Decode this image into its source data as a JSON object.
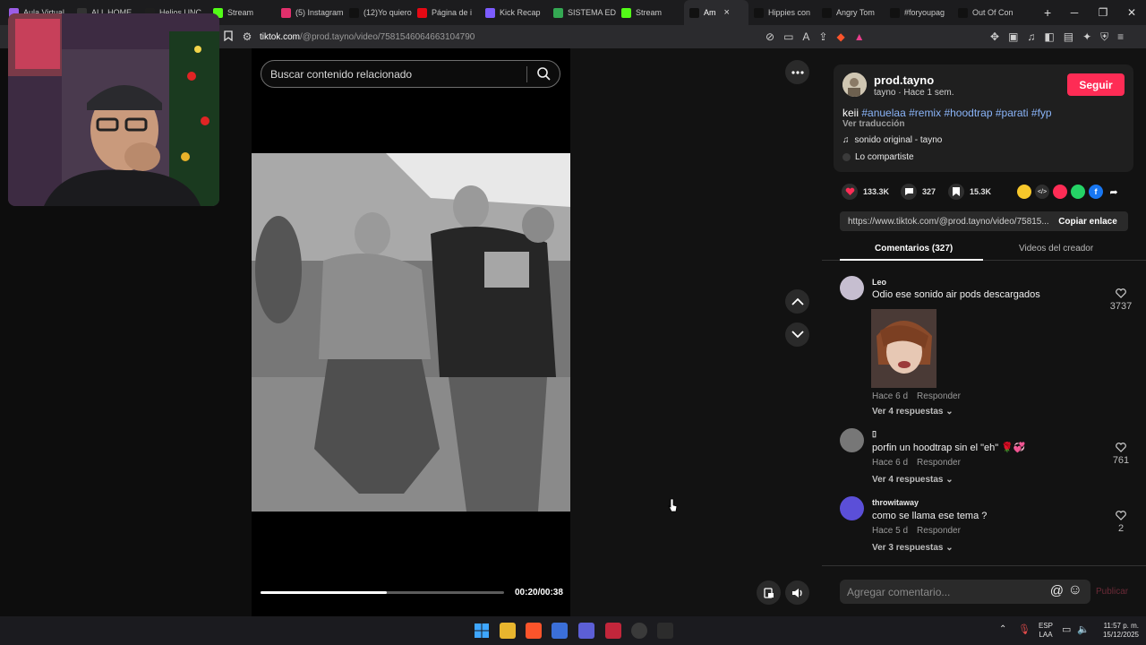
{
  "browser": {
    "tabs": [
      {
        "label": "Aula Virtual",
        "color": "#9b5de5"
      },
      {
        "label": "ALL HOME",
        "color": "#333333"
      },
      {
        "label": "Helios UNC",
        "color": "#1e1e1e"
      },
      {
        "label": "Stream",
        "color": "#53fc18"
      },
      {
        "label": "(5) Instagram",
        "color": "#e1306c"
      },
      {
        "label": "(12)Yo quiero",
        "color": "#111111"
      },
      {
        "label": "Página de i",
        "color": "#e50914"
      },
      {
        "label": "Kick Recap",
        "color": "#7c5cff"
      },
      {
        "label": "SISTEMA ED",
        "color": "#34a853"
      },
      {
        "label": "Stream",
        "color": "#53fc18"
      },
      {
        "label": "Am",
        "color": "#111111",
        "active": true
      },
      {
        "label": "Hippies con",
        "color": "#111111"
      },
      {
        "label": "Angry Tom",
        "color": "#111111"
      },
      {
        "label": "#foryoupag",
        "color": "#111111"
      },
      {
        "label": "Out Of Con",
        "color": "#111111"
      }
    ],
    "new_tab": "+",
    "url_domain": "tiktok.com",
    "url_path": "/@prod.tayno/video/7581546064663104790"
  },
  "video": {
    "search_placeholder": "Buscar contenido relacionado",
    "timecode": "00:20/00:38",
    "progress": 0.52
  },
  "author": {
    "username": "prod.tayno",
    "subtitle": "tayno · Hace 1 sem.",
    "follow_label": "Seguir",
    "caption_prefix": "keii",
    "hashtags": [
      "#anuelaa",
      "#remix",
      "#hoodtrap",
      "#parati",
      "#fyp"
    ],
    "translate_label": "Ver traducción",
    "sound": "sonido original - tayno",
    "shared_label": "Lo compartiste"
  },
  "stats": {
    "likes": "133.3K",
    "comments": "327",
    "saves": "15.3K"
  },
  "link": {
    "url": "https://www.tiktok.com/@prod.tayno/video/75815...",
    "copy_label": "Copiar enlace"
  },
  "panel_tabs": {
    "comments": "Comentarios (327)",
    "creator_videos": "Videos del creador"
  },
  "comments": [
    {
      "user": "Leo",
      "text": "Odio ese sonido air pods descargados",
      "time": "Hace 6 d",
      "reply": "Responder",
      "replies": "Ver 4 respuestas",
      "likes": "3737",
      "avatar_color": "#b8b0c8"
    },
    {
      "user": "▯",
      "text": "porfin un hoodtrap sin el \"eh\" 🌹💞",
      "time": "Hace 6 d",
      "reply": "Responder",
      "replies": "Ver 4 respuestas",
      "likes": "761",
      "avatar_color": "#6a6a6a"
    },
    {
      "user": "throwitaway",
      "text": "como se llama ese tema ?",
      "time": "Hace 5 d",
      "reply": "Responder",
      "replies": "Ver 3 respuestas",
      "likes": "2",
      "avatar_color": "#5b4fd8"
    }
  ],
  "composer": {
    "placeholder": "Agregar comentario...",
    "publish_label": "Publicar",
    "at": "@",
    "emoji": "☺"
  },
  "taskbar": {
    "lang_top": "ESP",
    "lang_bottom": "LAA",
    "time": "11:57 p. m.",
    "date": "15/12/2025"
  }
}
